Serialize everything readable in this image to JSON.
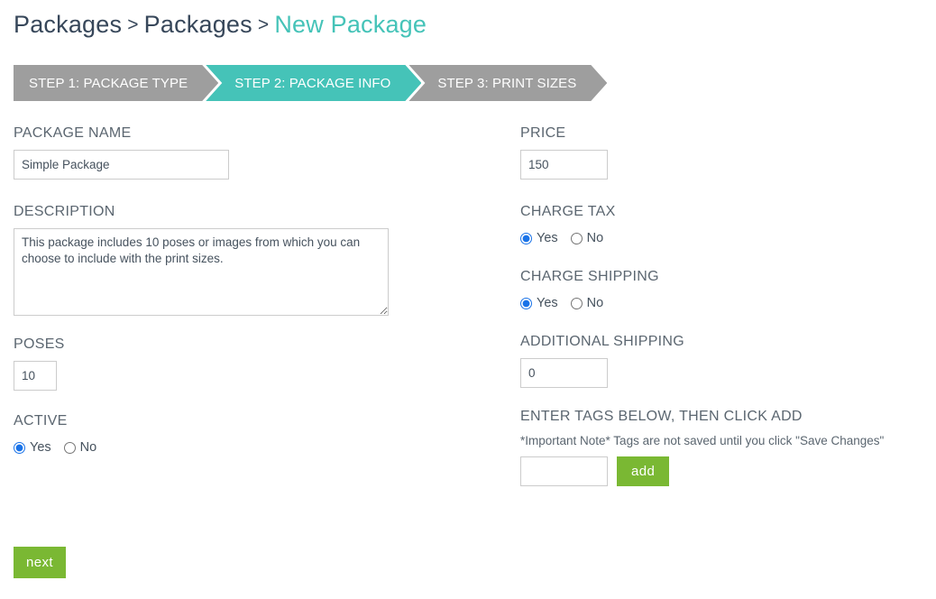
{
  "breadcrumb": {
    "items": [
      "Packages",
      "Packages"
    ],
    "separator": ">",
    "current": "New Package",
    "current_color": "#45c3b8"
  },
  "steps": {
    "active_index": 1,
    "active_color": "#45c3b8",
    "inactive_color": "#9e9e9e",
    "items": [
      {
        "label": "STEP 1: PACKAGE TYPE"
      },
      {
        "label": "STEP 2: PACKAGE INFO"
      },
      {
        "label": "STEP 3: PRINT SIZES"
      }
    ]
  },
  "left_column": {
    "package_name": {
      "label": "PACKAGE NAME",
      "value": "Simple Package",
      "placeholder": ""
    },
    "description": {
      "label": "DESCRIPTION",
      "value": "This package includes 10 poses or images from which you can choose to include with the print sizes.",
      "placeholder": ""
    },
    "poses": {
      "label": "POSES",
      "value": "10",
      "placeholder": ""
    },
    "active": {
      "label": "ACTIVE",
      "options": [
        "Yes",
        "No"
      ],
      "selected": "Yes"
    }
  },
  "right_column": {
    "price": {
      "label": "PRICE",
      "value": "150",
      "placeholder": ""
    },
    "charge_tax": {
      "label": "CHARGE TAX",
      "options": [
        "Yes",
        "No"
      ],
      "selected": "Yes"
    },
    "charge_shipping": {
      "label": "CHARGE SHIPPING",
      "options": [
        "Yes",
        "No"
      ],
      "selected": "Yes"
    },
    "additional_shipping": {
      "label": "ADDITIONAL SHIPPING",
      "value": "0",
      "placeholder": ""
    },
    "tags": {
      "label": "ENTER TAGS BELOW, THEN CLICK ADD",
      "note": "*Important Note* Tags are not saved until you click \"Save Changes\"",
      "value": "",
      "placeholder": "",
      "add_label": "add",
      "add_color": "#7ab833"
    }
  },
  "footer": {
    "next_label": "next",
    "next_color": "#7ab833"
  }
}
